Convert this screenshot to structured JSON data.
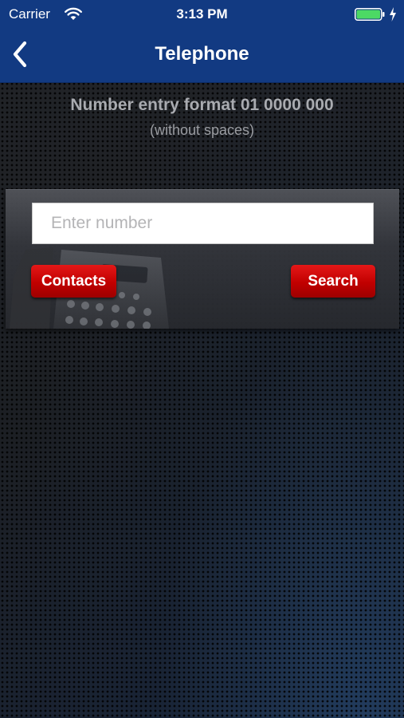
{
  "status_bar": {
    "carrier": "Carrier",
    "time": "3:13 PM",
    "wifi_icon": "wifi-icon",
    "battery_icon": "battery-icon",
    "battery_level": 1.0,
    "battery_color": "#4cd964",
    "charging_icon": "charging-bolt-icon"
  },
  "nav": {
    "back_icon": "chevron-left-icon",
    "title": "Telephone",
    "bar_color": "#123a82"
  },
  "header": {
    "format_text": "Number entry format 01 0000 000",
    "format_note": "(without spaces)"
  },
  "search": {
    "placeholder": "Enter number",
    "value": "",
    "contacts_label": "Contacts",
    "search_label": "Search",
    "button_color": "#c10000"
  }
}
